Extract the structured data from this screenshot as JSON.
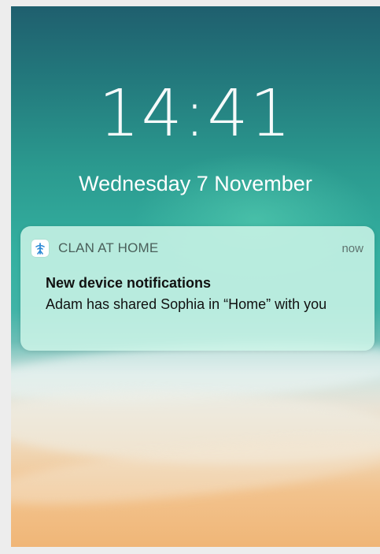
{
  "lock_screen": {
    "time": "14:41",
    "date": "Wednesday 7 November"
  },
  "notification": {
    "app_name": "CLAN AT HOME",
    "app_icon": "antenna-icon",
    "timestamp": "now",
    "title": "New device notifications",
    "body": "Adam has shared Sophia in “Home” with you"
  },
  "colors": {
    "accent": "#2f8bd6",
    "notification_bg": "#cdf5e8"
  }
}
